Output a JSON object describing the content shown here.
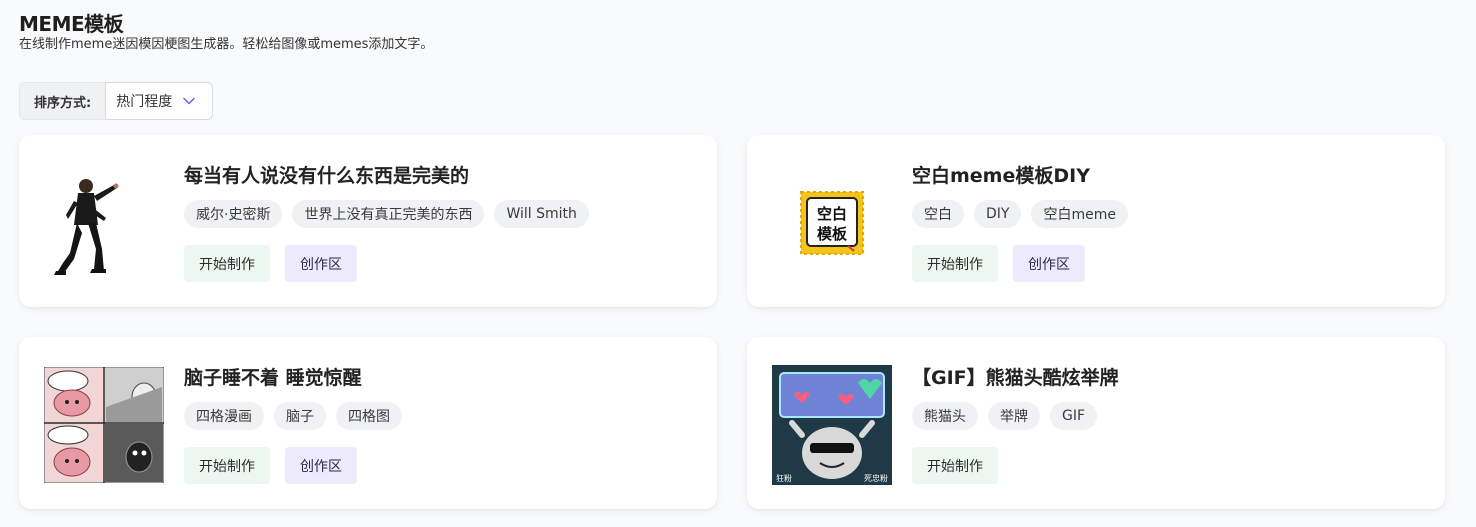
{
  "page": {
    "title": "MEME模板",
    "subtitle": "在线制作meme迷因模因梗图生成器。轻松给图像或memes添加文字。"
  },
  "sort": {
    "label": "排序方式:",
    "selected": "热门程度"
  },
  "cards": [
    {
      "title": "每当有人说没有什么东西是完美的",
      "tags": [
        "威尔·史密斯",
        "世界上没有真正完美的东西",
        "Will Smith"
      ],
      "start_label": "开始制作",
      "zone_label": "创作区"
    },
    {
      "title": "空白meme模板DIY",
      "tags": [
        "空白",
        "DIY",
        "空白meme"
      ],
      "start_label": "开始制作",
      "zone_label": "创作区",
      "thumb_text_1": "空白",
      "thumb_text_2": "模板"
    },
    {
      "title": "脑子睡不着 睡觉惊醒",
      "tags": [
        "四格漫画",
        "脑子",
        "四格图"
      ],
      "start_label": "开始制作",
      "zone_label": "创作区"
    },
    {
      "title": "【GIF】熊猫头酷炫举牌",
      "tags": [
        "熊猫头",
        "举牌",
        "GIF"
      ],
      "start_label": "开始制作",
      "thumb_caption_left": "狂粉",
      "thumb_caption_right": "死忠粉"
    }
  ],
  "colors": {
    "start_bg": "#edf7f1",
    "zone_bg": "#eceafc",
    "tag_bg": "#f0f1f3"
  },
  "icons": {
    "sort_dropdown": "chevron-down-icon"
  }
}
